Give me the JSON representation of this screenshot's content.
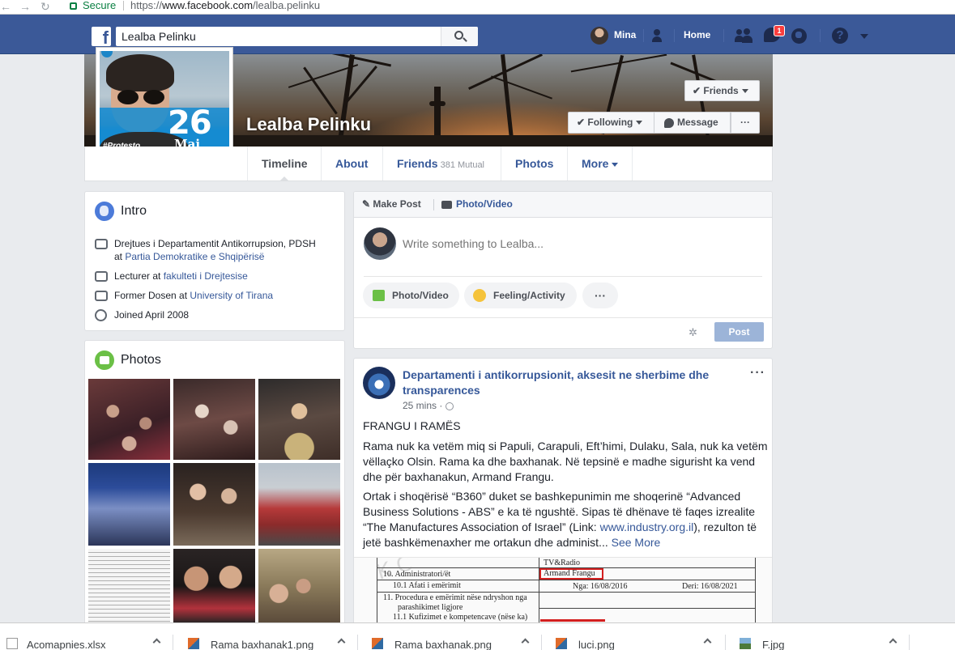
{
  "browser": {
    "secure_label": "Secure",
    "url_scheme": "https://",
    "url_host": "www.facebook.com",
    "url_path": "/lealba.pelinku"
  },
  "topbar": {
    "logo": "f",
    "search_value": "Lealba Pelinku",
    "user_name": "Mina",
    "home_label": "Home",
    "messages_badge": "1",
    "help_label": "?"
  },
  "profile": {
    "name": "Lealba Pelinku",
    "pic_text_number": "26",
    "pic_text_month": "Maj",
    "pic_hashtag": "#Protesto",
    "friends_button": "Friends",
    "following_button": "Following",
    "message_button": "Message",
    "more_button": "···"
  },
  "tabs": [
    {
      "label": "Timeline"
    },
    {
      "label": "About"
    },
    {
      "label": "Friends",
      "sub": "381 Mutual"
    },
    {
      "label": "Photos"
    },
    {
      "label": "More"
    }
  ],
  "intro": {
    "title": "Intro",
    "rows": [
      {
        "text": "Drejtues i Departamentit Antikorrupsion, PDSH",
        "line2_prefix": "at ",
        "line2_link": "Partia Demokratike e Shqipërisë"
      },
      {
        "prefix": "Lecturer at ",
        "link": "fakulteti i Drejtesise"
      },
      {
        "prefix": "Former Dosen at ",
        "link": "University of Tirana"
      },
      {
        "text": "Joined April 2008"
      }
    ]
  },
  "photos": {
    "title": "Photos"
  },
  "composer": {
    "tab_make_post": "Make Post",
    "tab_photo_video": "Photo/Video",
    "placeholder": "Write something to Lealba...",
    "btn_photo": "Photo/Video",
    "btn_feeling": "Feeling/Activity",
    "btn_more": "···",
    "post_label": "Post"
  },
  "post": {
    "author": "Departamenti i antikorrupsionit, aksesit ne sherbime dhe transparences",
    "author_line1": "Departamenti i antikorrupsionit, aksesit ne sherbime dhe",
    "author_line2": "transparences",
    "time": "25 mins",
    "title": "FRANGU I RAMËS",
    "para1": "Rama nuk ka vetëm miq si Papuli, Carapuli, Eft’himi, Dulaku, Sala, nuk ka vetëm vëllaçko Olsin. Rama ka dhe baxhanak. Në tepsinë e madhe sigurisht ka vend dhe për baxhanakun, Armand Frangu.",
    "para2_a": "Ortak i shoqërisë “B360” duket se bashkepunimin me shoqerinë “Advanced Business Solutions - ABS” e ka të ngushtë. Sipas të dhënave të faqes izrealite “The Manufactures Association of Israel” (Link: ",
    "para2_link": "www.industry.org.il",
    "para2_b": "), rezulton të jetë bashkëmenaxher me ortakun dhe administ...",
    "see_more": "See More",
    "doc": {
      "row0": "TV&Radio",
      "row1_num": "10. Administratori/ët",
      "row1_val": "Armand Frangu",
      "row2_num": "10.1 Afati i emërimit",
      "row2_from": "Nga: 16/08/2016",
      "row2_to": "Deri: 16/08/2021",
      "row3_num": "11. Procedura e emërimit nëse ndryshon nga",
      "row3b": "parashikimet ligjore",
      "row4_num": "11.1 Kufizimet e kompetencave (nëse ka)"
    }
  },
  "downloads": [
    {
      "name": "Acomapnies.xlsx"
    },
    {
      "name": "Rama baxhanak1.png"
    },
    {
      "name": "Rama baxhanak.png"
    },
    {
      "name": "luci.png"
    },
    {
      "name": "F.jpg"
    }
  ],
  "colors": {
    "fb_blue": "#3b5998",
    "link": "#365899",
    "badge_red": "#fa3e3e",
    "page_bg": "#e9ebee"
  }
}
